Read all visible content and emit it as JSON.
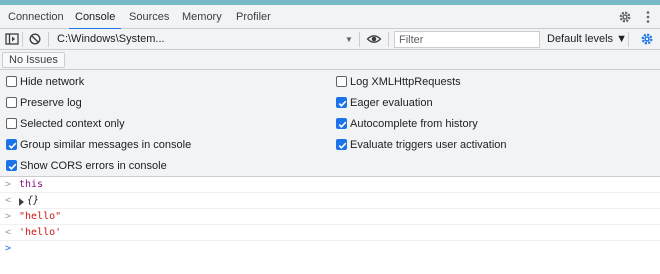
{
  "tabs": [
    {
      "label": "Connection",
      "active": false
    },
    {
      "label": "Console",
      "active": true
    },
    {
      "label": "Sources",
      "active": false
    },
    {
      "label": "Memory",
      "active": false
    },
    {
      "label": "Profiler",
      "active": false
    }
  ],
  "header_icons": [
    "gear-icon",
    "kebab-menu-icon"
  ],
  "toolbar": {
    "sidebar_icon": "sidebar-toggle-icon",
    "clear_icon": "clear-console-icon",
    "context": "C:\\Windows\\System...",
    "eye_icon": "eye-icon",
    "filter_placeholder": "Filter",
    "levels": "Default levels ▼",
    "settings_icon": "gear-icon"
  },
  "issues_button": "No Issues",
  "settings": {
    "left": [
      {
        "label": "Hide network",
        "checked": false
      },
      {
        "label": "Preserve log",
        "checked": false
      },
      {
        "label": "Selected context only",
        "checked": false
      },
      {
        "label": "Group similar messages in console",
        "checked": true
      },
      {
        "label": "Show CORS errors in console",
        "checked": true
      }
    ],
    "right": [
      {
        "label": "Log XMLHttpRequests",
        "checked": false
      },
      {
        "label": "Eager evaluation",
        "checked": true
      },
      {
        "label": "Autocomplete from history",
        "checked": true
      },
      {
        "label": "Evaluate triggers user activation",
        "checked": true
      }
    ]
  },
  "console": [
    {
      "kind": "input",
      "text": "this"
    },
    {
      "kind": "output",
      "text": "{}"
    },
    {
      "kind": "input",
      "text": "\"hello\""
    },
    {
      "kind": "output",
      "text": "'hello'"
    },
    {
      "kind": "prompt",
      "text": ""
    }
  ],
  "colors": {
    "accent": "#1a73e8",
    "topbar": "#78b9c8",
    "panel": "#f1f3f4"
  }
}
